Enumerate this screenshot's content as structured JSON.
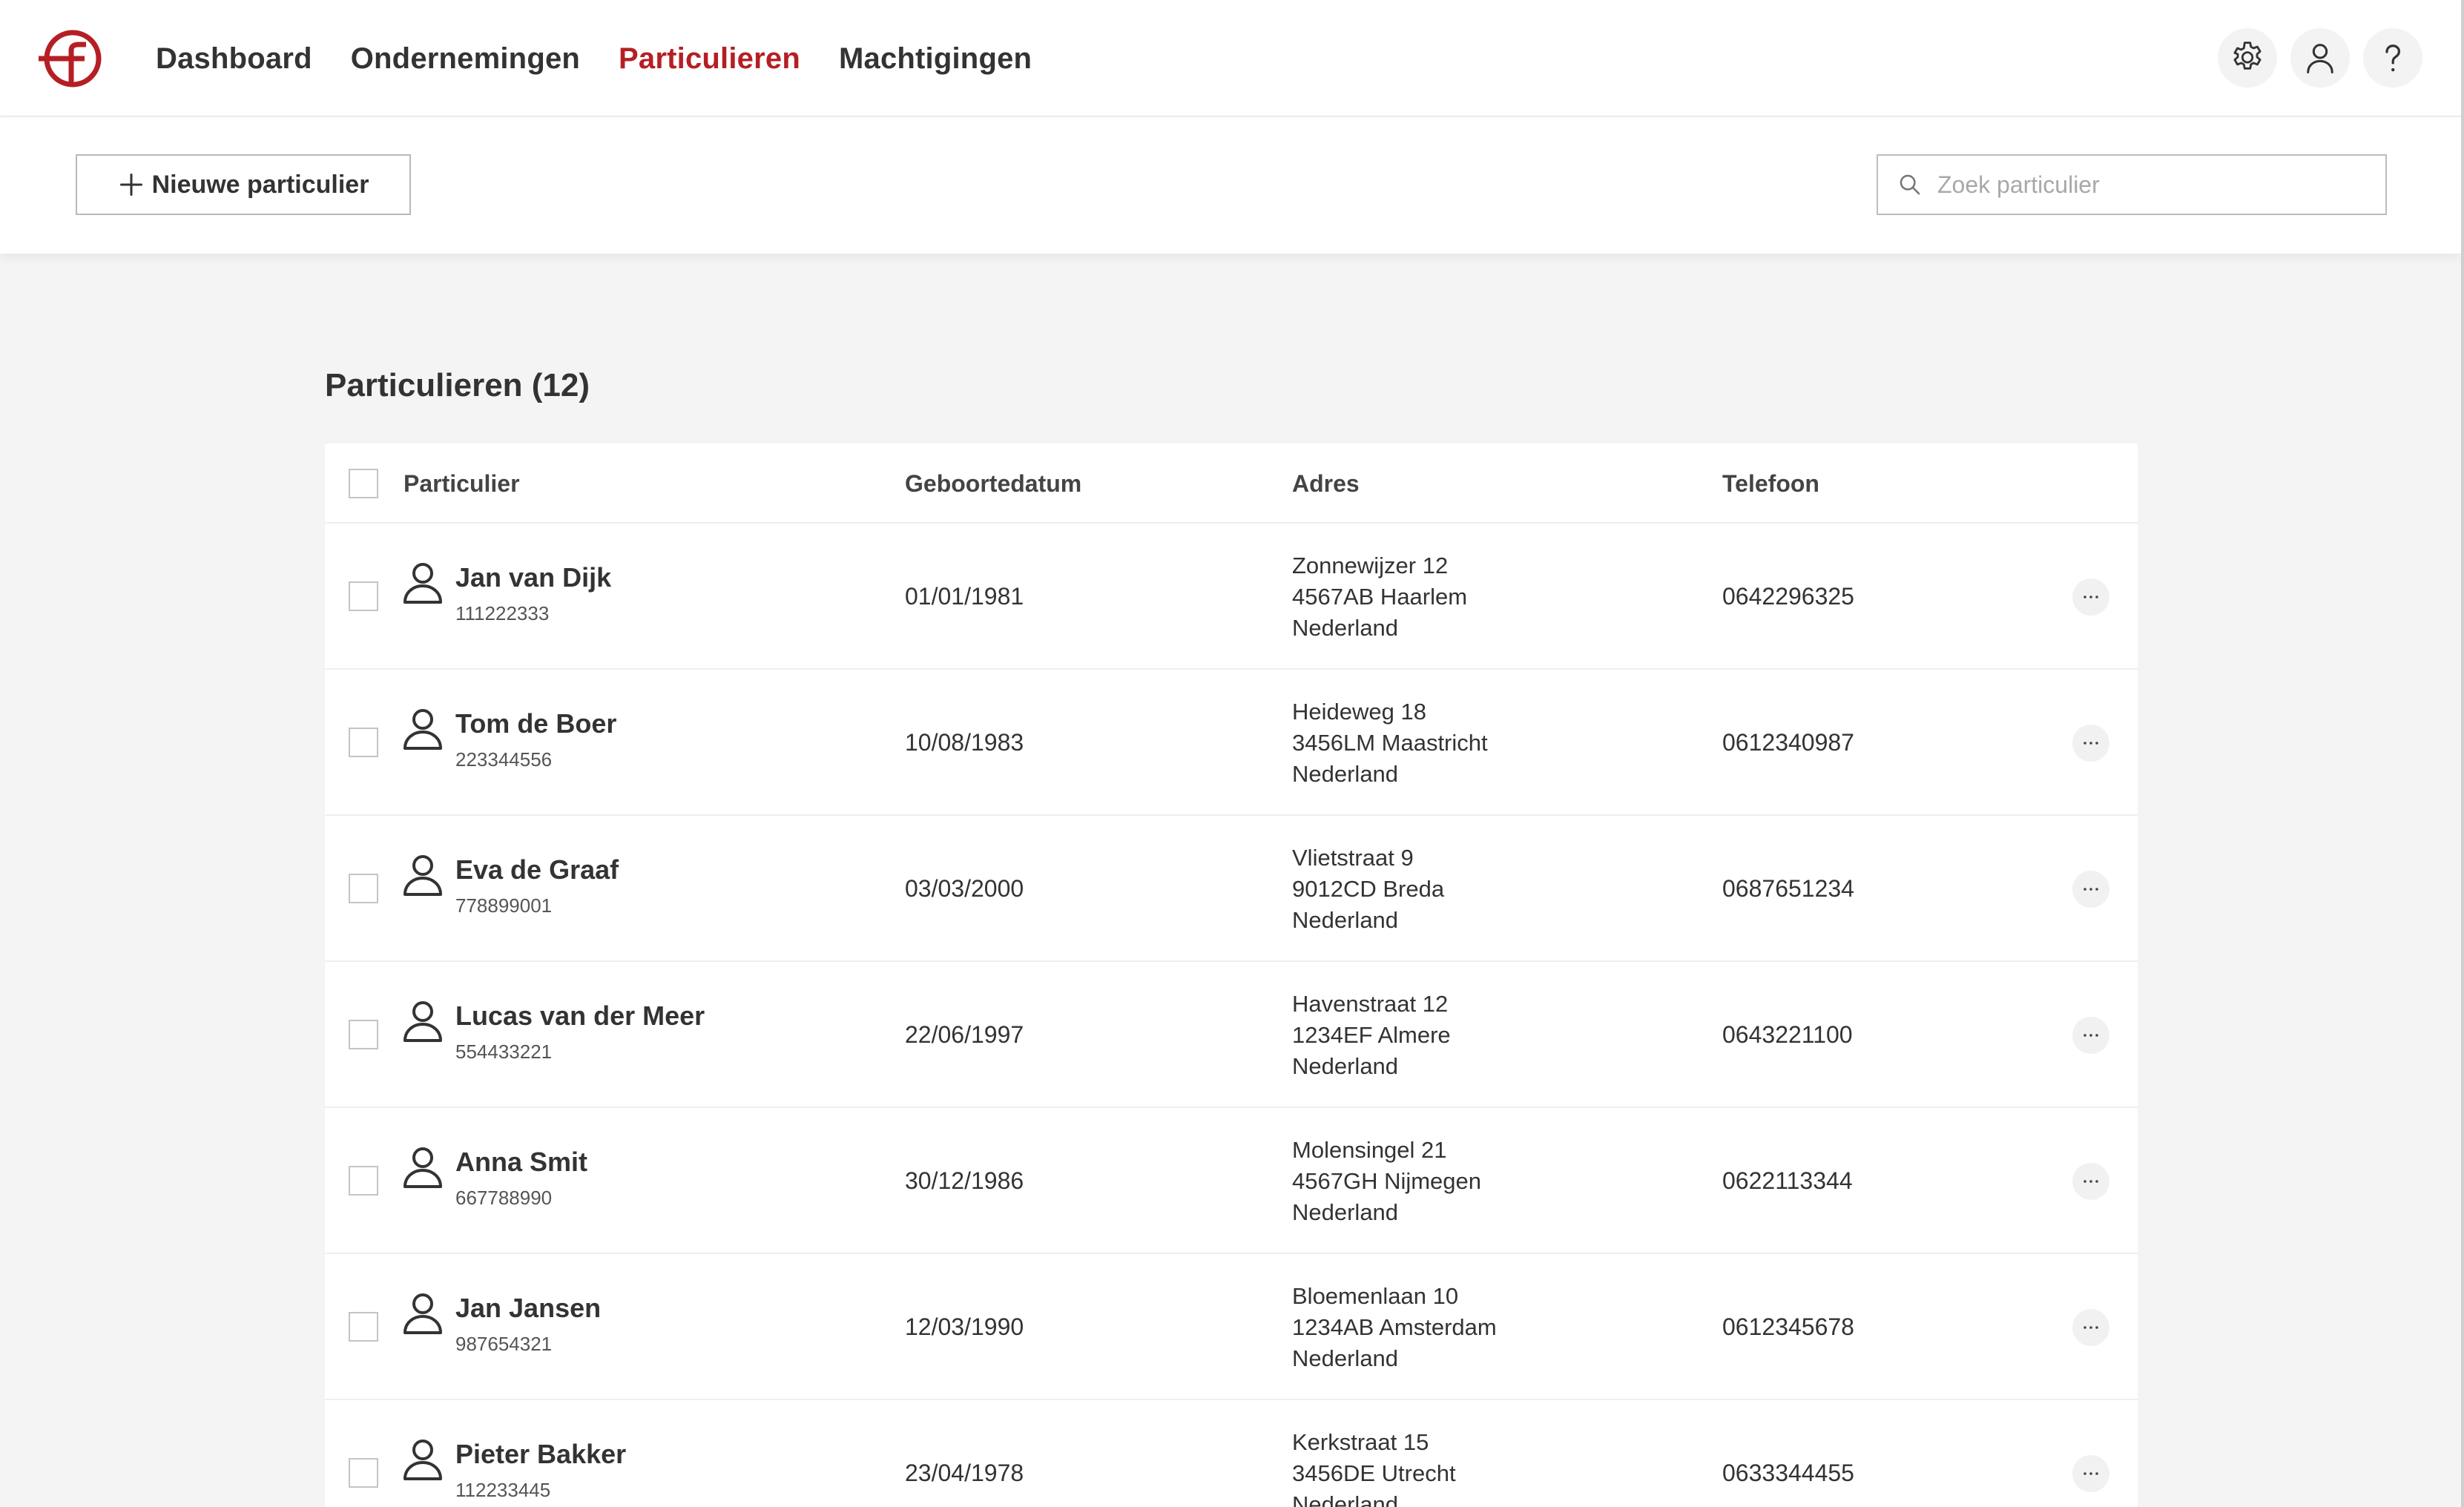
{
  "brand": {
    "accent": "#b51f24"
  },
  "nav": {
    "items": [
      {
        "label": "Dashboard",
        "active": false
      },
      {
        "label": "Ondernemingen",
        "active": false
      },
      {
        "label": "Particulieren",
        "active": true
      },
      {
        "label": "Machtigingen",
        "active": false
      }
    ],
    "icons": [
      "gear-icon",
      "user-icon",
      "help-icon"
    ]
  },
  "toolbar": {
    "new_label": "Nieuwe particulier",
    "search_placeholder": "Zoek particulier",
    "search_value": ""
  },
  "main": {
    "title": "Particulieren (12)",
    "table": {
      "headers": {
        "name": "Particulier",
        "dob": "Geboortedatum",
        "address": "Adres",
        "phone": "Telefoon"
      },
      "rows": [
        {
          "name": "Jan van Dijk",
          "bsn": "111222333",
          "dob": "01/01/1981",
          "address": [
            "Zonnewijzer 12",
            "4567AB Haarlem",
            "Nederland"
          ],
          "phone": "0642296325"
        },
        {
          "name": "Tom de Boer",
          "bsn": "223344556",
          "dob": "10/08/1983",
          "address": [
            "Heideweg 18",
            "3456LM Maastricht",
            "Nederland"
          ],
          "phone": "0612340987"
        },
        {
          "name": "Eva de Graaf",
          "bsn": "778899001",
          "dob": "03/03/2000",
          "address": [
            "Vlietstraat 9",
            "9012CD Breda",
            "Nederland"
          ],
          "phone": "0687651234"
        },
        {
          "name": "Lucas van der Meer",
          "bsn": "554433221",
          "dob": "22/06/1997",
          "address": [
            "Havenstraat 12",
            "1234EF Almere",
            "Nederland"
          ],
          "phone": "0643221100"
        },
        {
          "name": "Anna Smit",
          "bsn": "667788990",
          "dob": "30/12/1986",
          "address": [
            "Molensingel 21",
            "4567GH Nijmegen",
            "Nederland"
          ],
          "phone": "0622113344"
        },
        {
          "name": "Jan Jansen",
          "bsn": "987654321",
          "dob": "12/03/1990",
          "address": [
            "Bloemenlaan 10",
            "1234AB Amsterdam",
            "Nederland"
          ],
          "phone": "0612345678"
        },
        {
          "name": "Pieter Bakker",
          "bsn": "112233445",
          "dob": "23/04/1978",
          "address": [
            "Kerkstraat 15",
            "3456DE Utrecht",
            "Nederland"
          ],
          "phone": "0633344455"
        }
      ]
    }
  }
}
